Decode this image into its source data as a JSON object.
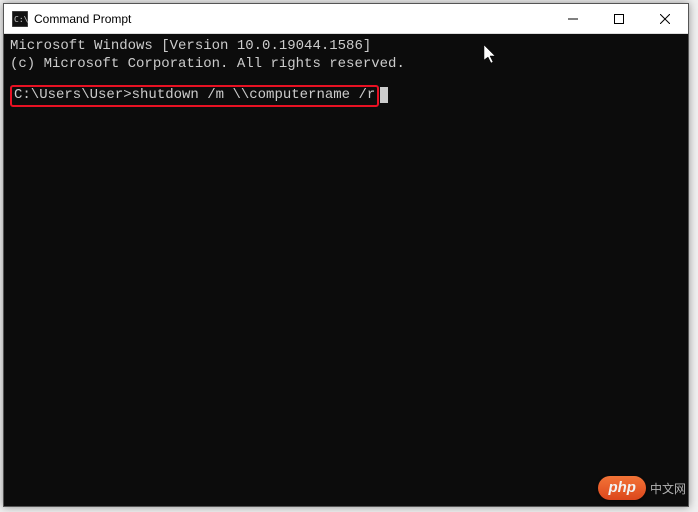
{
  "window": {
    "title": "Command Prompt"
  },
  "terminal": {
    "line_version": "Microsoft Windows [Version 10.0.19044.1586]",
    "line_copyright": "(c) Microsoft Corporation. All rights reserved.",
    "prompt": "C:\\Users\\User>",
    "command": "shutdown /m \\\\computername /r"
  },
  "watermark": {
    "badge": "php",
    "text": "中文网"
  }
}
